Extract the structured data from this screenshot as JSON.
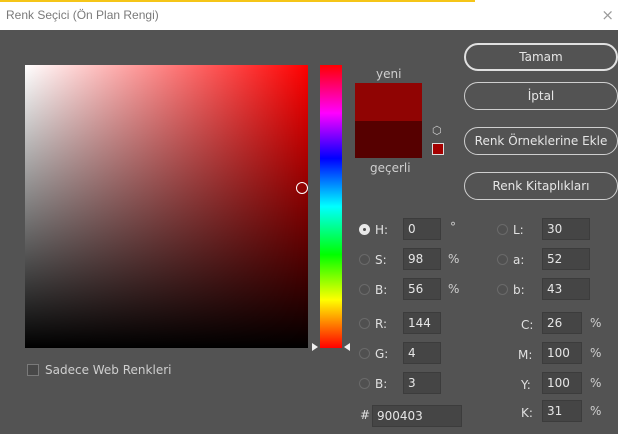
{
  "window": {
    "title": "Renk Seçici (Ön Plan Rengi)",
    "close": "×"
  },
  "swatches": {
    "new_label": "yeni",
    "current_label": "geçerli",
    "new_color": "#900403",
    "current_color": "#560000"
  },
  "buttons": {
    "ok": "Tamam",
    "cancel": "İptal",
    "add_to_swatches": "Renk Örneklerine Ekle",
    "libraries": "Renk Kitaplıkları"
  },
  "web_only": {
    "label": "Sadece Web Renkleri"
  },
  "hsb": {
    "h": {
      "label": "H:",
      "value": "0",
      "unit": "°"
    },
    "s": {
      "label": "S:",
      "value": "98",
      "unit": "%"
    },
    "b": {
      "label": "B:",
      "value": "56",
      "unit": "%"
    }
  },
  "rgb": {
    "r": {
      "label": "R:",
      "value": "144"
    },
    "g": {
      "label": "G:",
      "value": "4"
    },
    "b": {
      "label": "B:",
      "value": "3"
    }
  },
  "lab": {
    "l": {
      "label": "L:",
      "value": "30"
    },
    "a": {
      "label": "a:",
      "value": "52"
    },
    "b": {
      "label": "b:",
      "value": "43"
    }
  },
  "cmyk": {
    "c": {
      "label": "C:",
      "value": "26",
      "unit": "%"
    },
    "m": {
      "label": "M:",
      "value": "100",
      "unit": "%"
    },
    "y": {
      "label": "Y:",
      "value": "100",
      "unit": "%"
    },
    "k": {
      "label": "K:",
      "value": "31",
      "unit": "%"
    }
  },
  "hex": {
    "label": "#",
    "value": "900403"
  }
}
